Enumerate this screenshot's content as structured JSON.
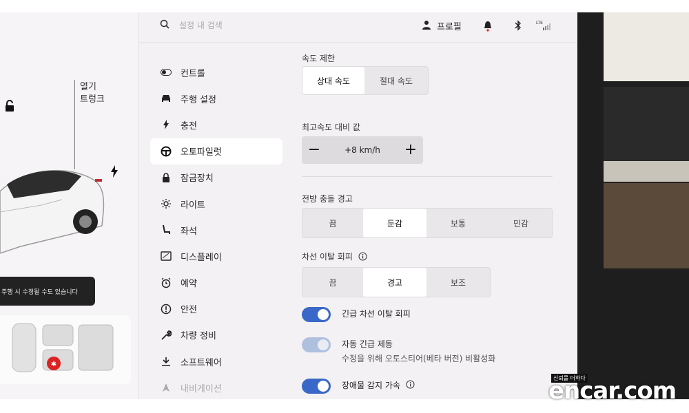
{
  "topbar": {
    "search_placeholder": "설정 내 검색",
    "profile_label": "프로필"
  },
  "car_panel": {
    "open_label": "열기",
    "trunk_label": "트렁크",
    "notice_text": "주행 시 수정될 수도 있습니다"
  },
  "sidebar": {
    "items": [
      {
        "label": "컨트롤",
        "icon": "toggle-icon"
      },
      {
        "label": "주행 설정",
        "icon": "car-icon"
      },
      {
        "label": "충전",
        "icon": "bolt-icon"
      },
      {
        "label": "오토파일럿",
        "icon": "steering-wheel-icon",
        "active": true
      },
      {
        "label": "잠금장치",
        "icon": "lock-icon"
      },
      {
        "label": "라이트",
        "icon": "sun-icon"
      },
      {
        "label": "좌석",
        "icon": "seat-icon"
      },
      {
        "label": "디스플레이",
        "icon": "display-icon"
      },
      {
        "label": "예약",
        "icon": "alarm-icon"
      },
      {
        "label": "안전",
        "icon": "alert-circle-icon"
      },
      {
        "label": "차량 정비",
        "icon": "wrench-icon"
      },
      {
        "label": "소프트웨어",
        "icon": "download-icon"
      },
      {
        "label": "내비게이션",
        "icon": "navigation-icon"
      }
    ]
  },
  "speed_limit": {
    "label": "속도 제한",
    "options": [
      "상대 속도",
      "절대 속도"
    ],
    "selected": "상대 속도"
  },
  "max_speed_offset": {
    "label": "최고속도 대비 값",
    "minus": "−",
    "value": "+8 km/h",
    "plus": "+"
  },
  "forward_collision": {
    "label": "전방 충돌 경고",
    "options": [
      "끔",
      "둔감",
      "보통",
      "민감"
    ],
    "selected": "둔감"
  },
  "lane_departure": {
    "label": "차선 이탈 회피",
    "options": [
      "끔",
      "경고",
      "보조"
    ],
    "selected": "경고"
  },
  "toggles": {
    "emergency_lane": {
      "label": "긴급 차선 이탈 회피",
      "on": true
    },
    "auto_emergency_braking": {
      "label": "자동 긴급 제동",
      "sub": "수정을 위해 오토스티어(베타 버전) 비활성화",
      "on": true,
      "disabled": true
    },
    "obstacle_accel": {
      "label": "장애물 감지 가속",
      "on": true
    }
  },
  "watermark": {
    "tagline": "신뢰를 더하다",
    "brand": "encar.com"
  },
  "colors": {
    "accent": "#3a68c8",
    "screen_bg": "#f3f1f3"
  }
}
